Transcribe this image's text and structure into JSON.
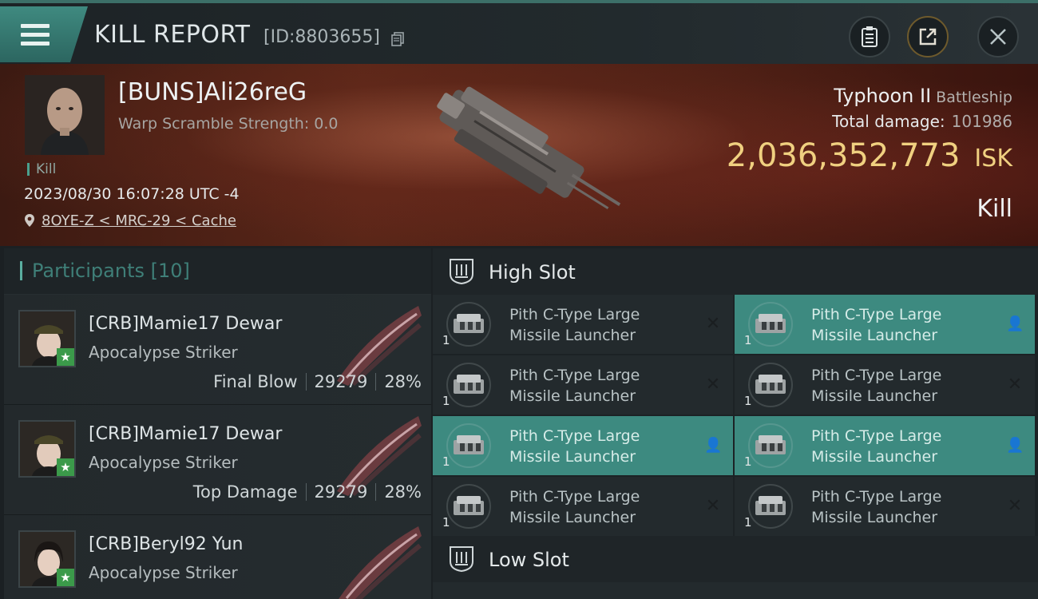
{
  "header": {
    "title": "KILL REPORT",
    "report_id": "[ID:8803655]"
  },
  "victim": {
    "pilot_name": "[BUNS]Ali26reG",
    "warp_scramble": "Warp Scramble Strength: 0.0",
    "kill_tag": "Kill",
    "datetime": "2023/08/30 16:07:28 UTC -4",
    "location": "8OYE-Z < MRC-29 < Cache",
    "ship_name": "Typhoon II",
    "ship_class": "Battleship",
    "total_damage_label": "Total damage:",
    "total_damage_value": "101986",
    "isk_value": "2,036,352,773",
    "isk_unit": "ISK",
    "result_label": "Kill"
  },
  "participants": {
    "label": "Participants",
    "count": "[10]",
    "rows": [
      {
        "name": "[CRB]Mamie17 Dewar",
        "ship": "Apocalypse Striker",
        "role": "Final Blow",
        "damage": "29279",
        "percent": "28%"
      },
      {
        "name": "[CRB]Mamie17 Dewar",
        "ship": "Apocalypse Striker",
        "role": "Top Damage",
        "damage": "29279",
        "percent": "28%"
      },
      {
        "name": "[CRB]Beryl92 Yun",
        "ship": "Apocalypse Striker",
        "role": "",
        "damage": "",
        "percent": ""
      }
    ]
  },
  "slots": {
    "high_label": "High Slot",
    "low_label": "Low Slot",
    "modules": [
      {
        "line1": "Pith C-Type Large",
        "line2": "Missile Launcher",
        "qty": "1",
        "state": "destroyed"
      },
      {
        "line1": "Pith C-Type Large",
        "line2": "Missile Launcher",
        "qty": "1",
        "state": "dropped"
      },
      {
        "line1": "Pith C-Type Large",
        "line2": "Missile Launcher",
        "qty": "1",
        "state": "destroyed"
      },
      {
        "line1": "Pith C-Type Large",
        "line2": "Missile Launcher",
        "qty": "1",
        "state": "destroyed"
      },
      {
        "line1": "Pith C-Type Large",
        "line2": "Missile Launcher",
        "qty": "1",
        "state": "dropped"
      },
      {
        "line1": "Pith C-Type Large",
        "line2": "Missile Launcher",
        "qty": "1",
        "state": "dropped"
      },
      {
        "line1": "Pith C-Type Large",
        "line2": "Missile Launcher",
        "qty": "1",
        "state": "destroyed"
      },
      {
        "line1": "Pith C-Type Large",
        "line2": "Missile Launcher",
        "qty": "1",
        "state": "destroyed"
      }
    ]
  },
  "colors": {
    "accent": "#3d8a80",
    "isk": "#f0d080",
    "participants_header": "#3f7f78"
  }
}
